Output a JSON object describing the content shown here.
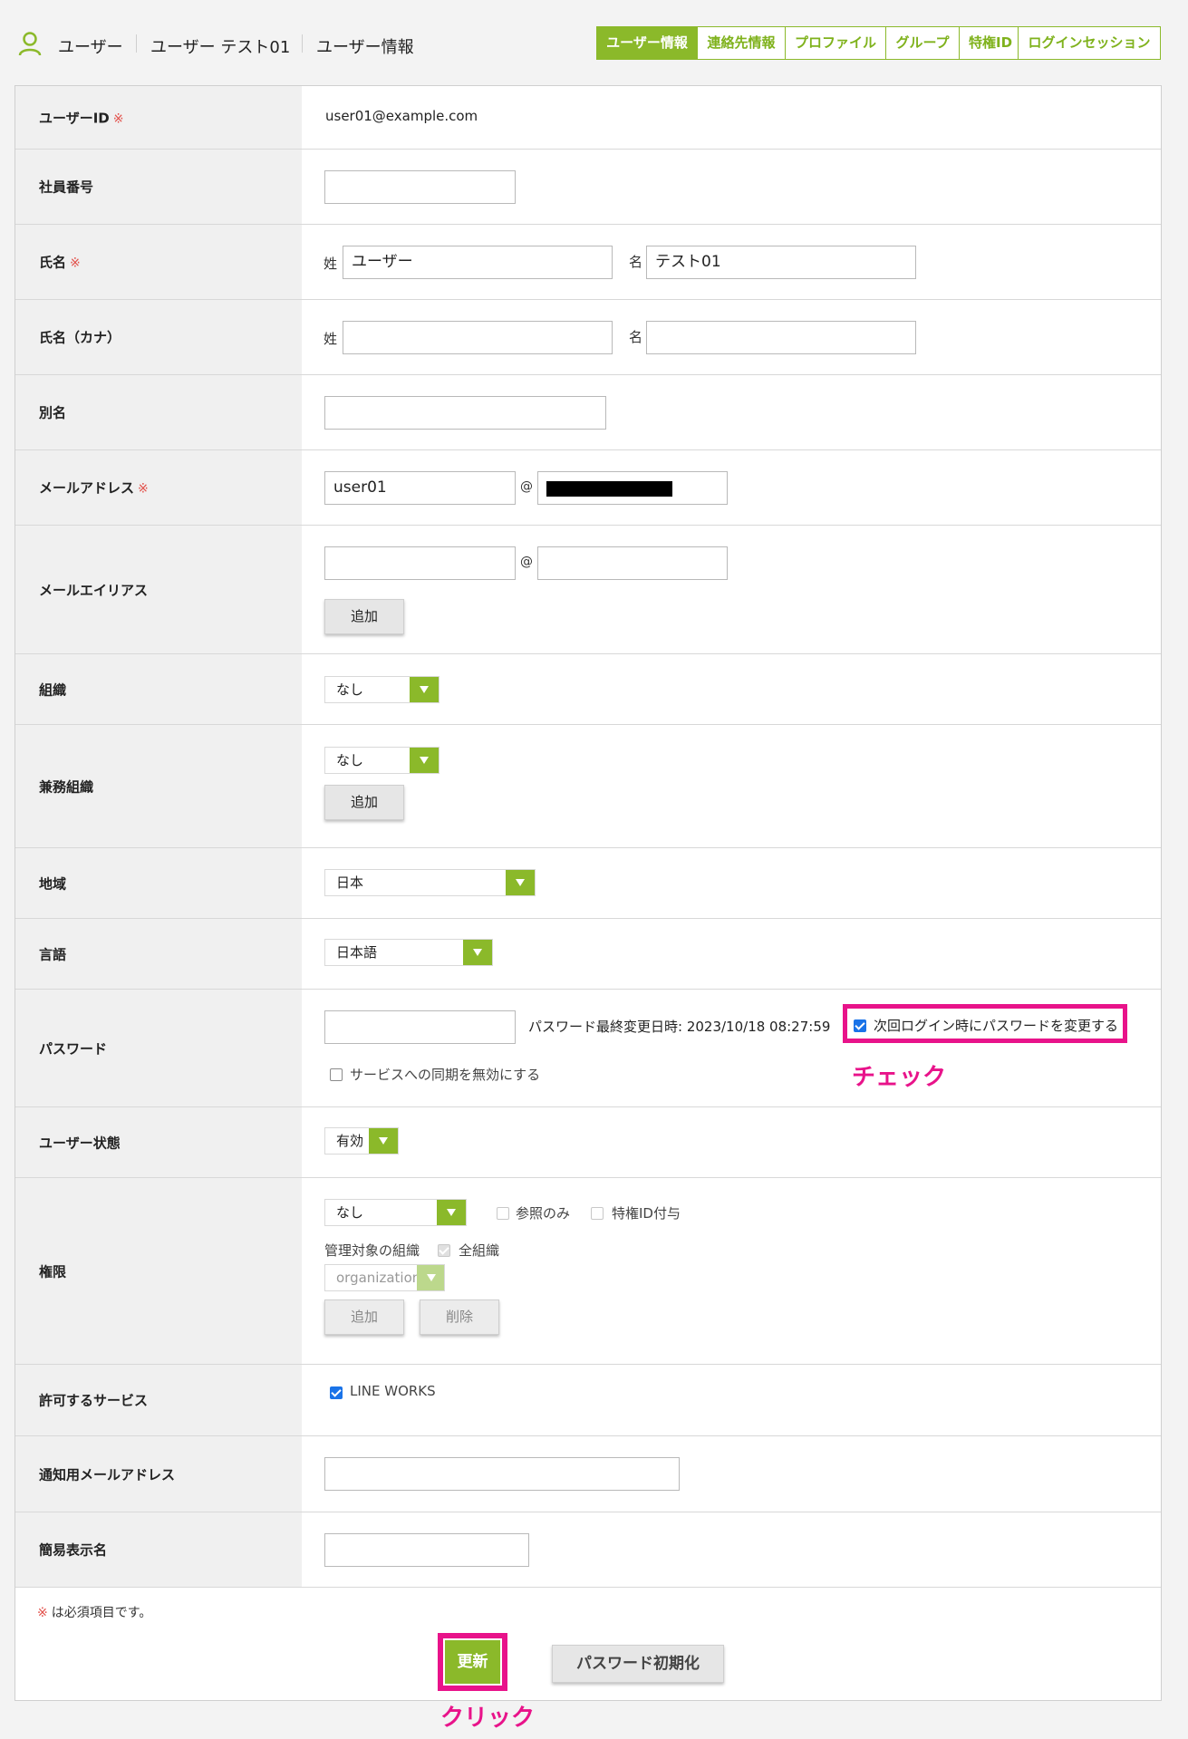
{
  "header": {
    "crumbs": [
      "ユーザー",
      "ユーザー テスト01",
      "ユーザー情報"
    ],
    "tabs": [
      "ユーザー情報",
      "連絡先情報",
      "プロファイル",
      "グループ",
      "特権ID",
      "ログインセッション"
    ],
    "active_tab": "ユーザー情報"
  },
  "required_mark": "※",
  "fields": {
    "user_id": {
      "label": "ユーザーID",
      "value": "user01@example.com"
    },
    "employee_no": {
      "label": "社員番号",
      "value": ""
    },
    "name": {
      "label": "氏名",
      "last_prefix": "姓",
      "last": "ユーザー",
      "first_prefix": "名",
      "first": "テスト01"
    },
    "kana": {
      "label": "氏名（カナ）",
      "last_prefix": "姓",
      "last": "",
      "first_prefix": "名",
      "first": ""
    },
    "alias": {
      "label": "別名",
      "value": ""
    },
    "email": {
      "label": "メールアドレス",
      "local": "user01",
      "at": "@"
    },
    "email_alias": {
      "label": "メールエイリアス",
      "at": "@",
      "add_button": "追加"
    },
    "org": {
      "label": "組織",
      "value": "なし"
    },
    "sub_org": {
      "label": "兼務組織",
      "value": "なし",
      "add_button": "追加"
    },
    "region": {
      "label": "地域",
      "value": "日本"
    },
    "language": {
      "label": "言語",
      "value": "日本語"
    },
    "password": {
      "label": "パスワード",
      "last_changed": "パスワード最終変更日時: 2023/10/18 08:27:59",
      "force_change": "次回ログイン時にパスワードを変更する",
      "force_change_checked": true,
      "disable_sync": "サービスへの同期を無効にする",
      "disable_sync_checked": false
    },
    "status": {
      "label": "ユーザー状態",
      "value": "有効"
    },
    "permission": {
      "label": "権限",
      "value": "なし",
      "readonly": "参照のみ",
      "privileged": "特権ID付与",
      "target_label": "管理対象の組織",
      "all_orgs": "全組織",
      "org_select": "organization",
      "add_button": "追加",
      "delete_button": "削除"
    },
    "services": {
      "label": "許可するサービス",
      "item": "LINE WORKS",
      "checked": true
    },
    "notify_email": {
      "label": "通知用メールアドレス",
      "value": ""
    },
    "short_name": {
      "label": "簡易表示名",
      "value": ""
    }
  },
  "footer": {
    "note_mark": "※",
    "note": "は必須項目です。",
    "update_button": "更新",
    "reset_password_button": "パスワード初期化"
  },
  "annotations": {
    "check": "チェック",
    "click": "クリック"
  },
  "colors": {
    "accent": "#8bb92a",
    "highlight": "#e8138a",
    "required": "#e2514b"
  }
}
